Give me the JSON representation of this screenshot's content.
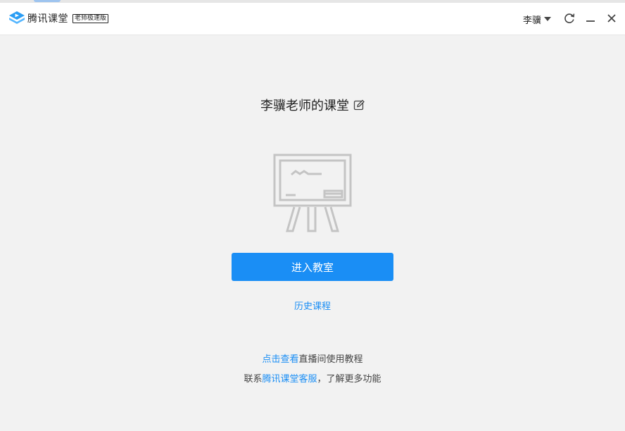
{
  "app": {
    "name": "腾讯课堂",
    "edition_badge": "老师极速版",
    "brand_color": "#1a8ef5"
  },
  "titlebar": {
    "username": "李骥",
    "icons": [
      "caret-down-icon",
      "refresh-icon",
      "minimize-icon",
      "close-icon"
    ]
  },
  "main": {
    "classroom_title": "李骥老师的课堂",
    "edit_icon": "edit-icon",
    "illustration": "blackboard-icon",
    "enter_button_label": "进入教室",
    "history_link_label": "历史课程"
  },
  "footer": {
    "tutorial_link": "点击查看",
    "tutorial_text": "直播间使用教程",
    "contact_prefix": "联系",
    "contact_link": "腾讯课堂客服",
    "contact_suffix": "，了解更多功能"
  }
}
